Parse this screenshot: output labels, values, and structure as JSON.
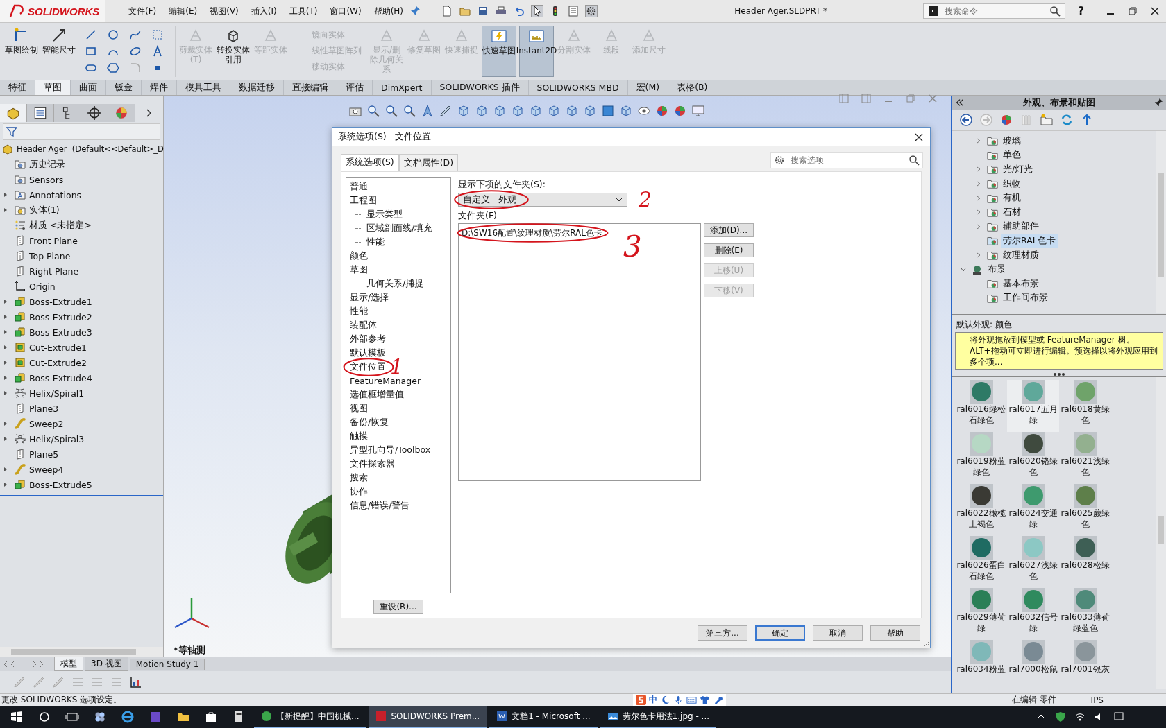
{
  "app": {
    "logo": "SOLIDWORKS",
    "menus": [
      "文件(F)",
      "编辑(E)",
      "视图(V)",
      "插入(I)",
      "工具(T)",
      "窗口(W)",
      "帮助(H)"
    ],
    "document_title": "Header Ager.SLDPRT *",
    "command_search": {
      "placeholder": "搜索命令"
    },
    "help_label": "?"
  },
  "ribbon": {
    "commands": [
      {
        "kind": "large",
        "label": "草图绘制",
        "enabled": true,
        "selected": false
      },
      {
        "kind": "large",
        "label": "智能尺寸",
        "enabled": true,
        "selected": false
      },
      {
        "kind": "sketch-tools"
      },
      {
        "kind": "large",
        "label": "剪裁实体(T)",
        "enabled": false,
        "selected": false
      },
      {
        "kind": "large",
        "label": "转换实体引用",
        "enabled": true,
        "selected": false
      },
      {
        "kind": "large",
        "label": "等距实体",
        "enabled": false,
        "selected": false
      },
      {
        "kind": "stack",
        "items": [
          {
            "label": "镜向实体",
            "enabled": false
          },
          {
            "label": "线性草图阵列",
            "enabled": false
          },
          {
            "label": "移动实体",
            "enabled": false
          }
        ]
      },
      {
        "kind": "large",
        "label": "显示/删除几何关系",
        "enabled": false,
        "selected": false
      },
      {
        "kind": "large",
        "label": "修复草图",
        "enabled": false,
        "selected": false
      },
      {
        "kind": "large",
        "label": "快速捕捉",
        "enabled": false,
        "selected": false
      },
      {
        "kind": "large",
        "label": "快速草图",
        "enabled": true,
        "selected": true
      },
      {
        "kind": "large",
        "label": "Instant2D",
        "enabled": true,
        "selected": true
      },
      {
        "kind": "large",
        "label": "分割实体",
        "enabled": false,
        "selected": false
      },
      {
        "kind": "large",
        "label": "线段",
        "enabled": false,
        "selected": false
      },
      {
        "kind": "large",
        "label": "添加尺寸",
        "enabled": false,
        "selected": false
      }
    ]
  },
  "ribbon_tabs": [
    {
      "label": "特征",
      "selected": false
    },
    {
      "label": "草图",
      "selected": true
    },
    {
      "label": "曲面",
      "selected": false
    },
    {
      "label": "钣金",
      "selected": false
    },
    {
      "label": "焊件",
      "selected": false
    },
    {
      "label": "模具工具",
      "selected": false
    },
    {
      "label": "数据迁移",
      "selected": false
    },
    {
      "label": "直接编辑",
      "selected": false
    },
    {
      "label": "评估",
      "selected": false
    },
    {
      "label": "DimXpert",
      "selected": false
    },
    {
      "label": "SOLIDWORKS 插件",
      "selected": false
    },
    {
      "label": "SOLIDWORKS MBD",
      "selected": false
    },
    {
      "label": "宏(M)",
      "selected": false
    },
    {
      "label": "表格(B)",
      "selected": false
    }
  ],
  "feature_tree": {
    "root": "Header Ager  (Default<<Default>_D",
    "items": [
      {
        "label": "历史记录",
        "kind": "history",
        "expandable": false
      },
      {
        "label": "Sensors",
        "kind": "sensors",
        "expandable": false
      },
      {
        "label": "Annotations",
        "kind": "annotations",
        "expandable": true
      },
      {
        "label": "实体(1)",
        "kind": "bodies",
        "expandable": true
      },
      {
        "label": "材质 <未指定>",
        "kind": "material",
        "expandable": false
      },
      {
        "label": "Front Plane",
        "kind": "plane",
        "expandable": false
      },
      {
        "label": "Top Plane",
        "kind": "plane",
        "expandable": false
      },
      {
        "label": "Right Plane",
        "kind": "plane",
        "expandable": false
      },
      {
        "label": "Origin",
        "kind": "origin",
        "expandable": false
      },
      {
        "label": "Boss-Extrude1",
        "kind": "boss",
        "expandable": true
      },
      {
        "label": "Boss-Extrude2",
        "kind": "boss",
        "expandable": true
      },
      {
        "label": "Boss-Extrude3",
        "kind": "boss",
        "expandable": true
      },
      {
        "label": "Cut-Extrude1",
        "kind": "cut",
        "expandable": true
      },
      {
        "label": "Cut-Extrude2",
        "kind": "cut",
        "expandable": true
      },
      {
        "label": "Boss-Extrude4",
        "kind": "boss",
        "expandable": true
      },
      {
        "label": "Helix/Spiral1",
        "kind": "helix",
        "expandable": true
      },
      {
        "label": "Plane3",
        "kind": "plane",
        "expandable": false
      },
      {
        "label": "Sweep2",
        "kind": "sweep",
        "expandable": true
      },
      {
        "label": "Helix/Spiral3",
        "kind": "helix",
        "expandable": true
      },
      {
        "label": "Plane5",
        "kind": "plane",
        "expandable": false
      },
      {
        "label": "Sweep4",
        "kind": "sweep",
        "expandable": true
      },
      {
        "label": "Boss-Extrude5",
        "kind": "boss",
        "expandable": true
      }
    ]
  },
  "viewport": {
    "view_name": "*等轴测"
  },
  "bottom_tabs": [
    {
      "label": "模型",
      "selected": true
    },
    {
      "label": "3D 视图",
      "selected": false
    },
    {
      "label": "Motion Study 1",
      "selected": false
    }
  ],
  "dialog": {
    "title": "系统选项(S) - 文件位置",
    "tabs": [
      {
        "label": "系统选项(S)",
        "selected": true
      },
      {
        "label": "文档属性(D)",
        "selected": false
      }
    ],
    "search": {
      "placeholder": "搜索选项"
    },
    "categories": [
      {
        "label": "普通",
        "circled": false
      },
      {
        "label": "工程图",
        "circled": false,
        "children": [
          {
            "label": "显示类型"
          },
          {
            "label": "区域剖面线/填充"
          },
          {
            "label": "性能"
          }
        ]
      },
      {
        "label": "颜色",
        "circled": false
      },
      {
        "label": "草图",
        "circled": false,
        "children": [
          {
            "label": "几何关系/捕捉"
          }
        ]
      },
      {
        "label": "显示/选择",
        "circled": false
      },
      {
        "label": "性能",
        "circled": false
      },
      {
        "label": "装配体",
        "circled": false
      },
      {
        "label": "外部参考",
        "circled": false
      },
      {
        "label": "默认模板",
        "circled": false
      },
      {
        "label": "文件位置",
        "circled": true,
        "note": "1"
      },
      {
        "label": "FeatureManager",
        "circled": false
      },
      {
        "label": "选值框增量值",
        "circled": false
      },
      {
        "label": "视图",
        "circled": false
      },
      {
        "label": "备份/恢复",
        "circled": false
      },
      {
        "label": "触摸",
        "circled": false
      },
      {
        "label": "异型孔向导/Toolbox",
        "circled": false
      },
      {
        "label": "文件探索器",
        "circled": false
      },
      {
        "label": "搜索",
        "circled": false
      },
      {
        "label": "协作",
        "circled": false
      },
      {
        "label": "信息/错误/警告",
        "circled": false
      }
    ],
    "reset_button": "重设(R)...",
    "folder_type": {
      "label": "显示下项的文件夹(S):",
      "value": "自定义 - 外观",
      "circled": true,
      "note": "2"
    },
    "folders": {
      "label": "文件夹(F)",
      "entries": [
        {
          "path": "D:\\SW16配置\\纹理材质\\劳尔RAL色卡",
          "circled": true,
          "note": "3"
        }
      ]
    },
    "side_buttons": [
      {
        "label": "添加(D)...",
        "enabled": true
      },
      {
        "label": "删除(E)",
        "enabled": true
      },
      {
        "label": "上移(U)",
        "enabled": false
      },
      {
        "label": "下移(V)",
        "enabled": false
      }
    ],
    "footer_buttons": [
      {
        "label": "第三方...",
        "default": false
      },
      {
        "label": "确定",
        "default": true
      },
      {
        "label": "取消",
        "default": false
      },
      {
        "label": "帮助",
        "default": false
      }
    ]
  },
  "task_pane": {
    "title": "外观、布景和贴图",
    "appearance_folders": [
      {
        "label": "玻璃",
        "expandable": true,
        "selected": false
      },
      {
        "label": "单色",
        "expandable": false,
        "selected": false
      },
      {
        "label": "光/灯光",
        "expandable": true,
        "selected": false
      },
      {
        "label": "织物",
        "expandable": true,
        "selected": false
      },
      {
        "label": "有机",
        "expandable": true,
        "selected": false
      },
      {
        "label": "石材",
        "expandable": true,
        "selected": false
      },
      {
        "label": "辅助部件",
        "expandable": true,
        "selected": false
      },
      {
        "label": "劳尔RAL色卡",
        "expandable": false,
        "selected": true
      },
      {
        "label": "纹理材质",
        "expandable": true,
        "selected": false
      }
    ],
    "scenes": {
      "label": "布景",
      "expanded": true,
      "children": [
        {
          "label": "基本布景"
        },
        {
          "label": "工作间布景"
        }
      ]
    },
    "info_label": "默认外观: 颜色",
    "tip": "将外观拖放到模型或 FeatureManager 树。ALT+拖动可立即进行编辑。预选择以将外观应用到多个项...",
    "swatches": [
      {
        "label": "ral6016绿松石绿色",
        "color": "#2e7a66",
        "selected": false
      },
      {
        "label": "ral6017五月绿",
        "color": "#5fa89a",
        "selected": true
      },
      {
        "label": "ral6018黄绿色",
        "color": "#6fa36a",
        "selected": false
      },
      {
        "label": "ral6019粉蓝绿色",
        "color": "#b6d8c4",
        "selected": false
      },
      {
        "label": "ral6020铬绿色",
        "color": "#3f4a3e",
        "selected": false
      },
      {
        "label": "ral6021浅绿色",
        "color": "#93b08f",
        "selected": false
      },
      {
        "label": "ral6022橄榄土褐色",
        "color": "#3a3a34",
        "selected": false
      },
      {
        "label": "ral6024交通绿",
        "color": "#3e9a6e",
        "selected": false
      },
      {
        "label": "ral6025蕨绿色",
        "color": "#5e7f4a",
        "selected": false
      },
      {
        "label": "ral6026蛋白石绿色",
        "color": "#1f6b62",
        "selected": false
      },
      {
        "label": "ral6027浅绿色",
        "color": "#8cc8c4",
        "selected": false
      },
      {
        "label": "ral6028松绿",
        "color": "#3e5f55",
        "selected": false
      },
      {
        "label": "ral6029薄荷绿",
        "color": "#2a7f56",
        "selected": false
      },
      {
        "label": "ral6032信号绿",
        "color": "#2f8a5e",
        "selected": false
      },
      {
        "label": "ral6033薄荷绿蓝色",
        "color": "#4f8a7a",
        "selected": false
      },
      {
        "label": "ral6034粉蓝",
        "color": "#7fb8b8",
        "selected": false
      },
      {
        "label": "ral7000松鼠",
        "color": "#7a8a94",
        "selected": false
      },
      {
        "label": "ral7001银灰",
        "color": "#8a959b",
        "selected": false
      }
    ]
  },
  "status_bar": {
    "message": "更改 SOLIDWORKS 选项设定。",
    "mode": "在编辑 零件",
    "units": "IPS"
  },
  "ime": {
    "mode": "中"
  },
  "taskbar": {
    "items": [
      {
        "label": "【新提醒】中国机械...",
        "kind": "browser",
        "active": false
      },
      {
        "label": "SOLIDWORKS Prem...",
        "kind": "solidworks",
        "active": true
      },
      {
        "label": "文档1 - Microsoft ...",
        "kind": "word",
        "active": false
      },
      {
        "label": "劳尔色卡用法1.jpg - ...",
        "kind": "image",
        "active": false
      }
    ]
  }
}
